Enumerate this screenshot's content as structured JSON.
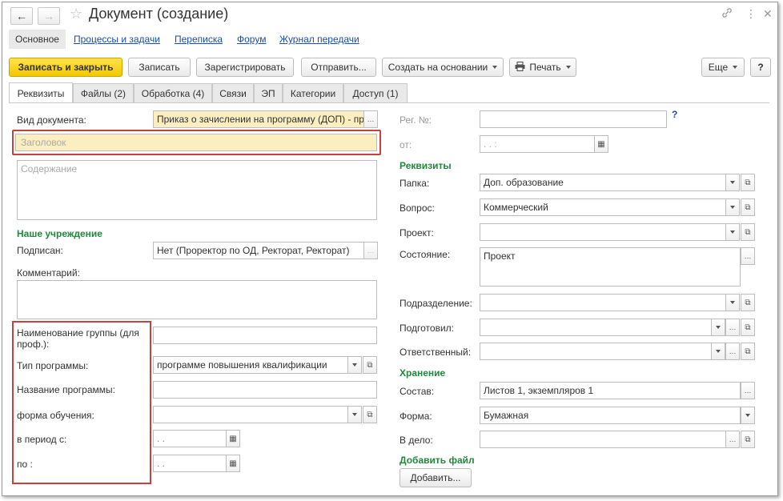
{
  "window": {
    "title": "Документ (создание)",
    "icons": {
      "back": "arrow-left-icon",
      "forward": "arrow-right-icon",
      "favorite": "star-icon",
      "link": "link-icon",
      "menu": "more-vertical-icon",
      "close": "close-icon"
    },
    "back_glyph": "←",
    "forward_glyph": "→",
    "star_glyph": "☆",
    "link_glyph": "🔗",
    "more_glyph": "⋮",
    "close_glyph": "✕"
  },
  "nav_tabs": [
    {
      "label": "Основное"
    },
    {
      "label": "Процессы и задачи"
    },
    {
      "label": "Переписка"
    },
    {
      "label": "Форум"
    },
    {
      "label": "Журнал передачи"
    }
  ],
  "toolbar": {
    "save_close": "Записать и закрыть",
    "save": "Записать",
    "register": "Зарегистрировать",
    "send": "Отправить...",
    "create_based": "Создать на основании",
    "print": "Печать",
    "more": "Еще",
    "help": "?"
  },
  "tabs": [
    {
      "label": "Реквизиты"
    },
    {
      "label": "Файлы (2)"
    },
    {
      "label": "Обработка (4)"
    },
    {
      "label": "Связи"
    },
    {
      "label": "ЭП"
    },
    {
      "label": "Категории"
    },
    {
      "label": "Доступ (1)"
    }
  ],
  "left": {
    "doc_type_label": "Вид документа:",
    "doc_type_value": "Приказ о зачислении на программу (ДОП) - пр",
    "title_placeholder": "Заголовок",
    "content_placeholder": "Содержание",
    "our_org_header": "Наше учреждение",
    "signed_label": "Подписан:",
    "signed_value": "Нет (Проректор по ОД, Ректорат, Ректорат)",
    "comment_label": "Комментарий:",
    "group_name_label": "Наименование группы (для проф.):",
    "program_type_label": "Тип программы:",
    "program_type_value": "программе повышения квалификации",
    "program_name_label": "Название программы:",
    "study_form_label": "форма обучения:",
    "period_from_label": "в период с:",
    "period_from_value": " .  .",
    "period_to_label": "по :",
    "period_to_value": " .  ."
  },
  "right": {
    "reg_no_label": "Рег. №:",
    "help_mark": "?",
    "date_label": "от:",
    "date_value": " .  .       :",
    "requisites_header": "Реквизиты",
    "folder_label": "Папка:",
    "folder_value": "Доп. образование",
    "question_label": "Вопрос:",
    "question_value": "Коммерческий",
    "project_label": "Проект:",
    "state_label": "Состояние:",
    "state_value": "Проект",
    "division_label": "Подразделение:",
    "prepared_label": "Подготовил:",
    "responsible_label": "Ответственный:",
    "storage_header": "Хранение",
    "composition_label": "Состав:",
    "composition_value": "Листов 1, экземпляров 1",
    "form_label": "Форма:",
    "form_value": "Бумажная",
    "to_case_label": "В дело:",
    "add_file_header": "Добавить файл",
    "add_button": "Добавить..."
  },
  "colors": {
    "primary_button": "#f2c800",
    "section_header": "#1e8a3a",
    "link": "#1a4fa6",
    "highlight_box": "#c8413a",
    "required_field": "#fbeec1"
  }
}
